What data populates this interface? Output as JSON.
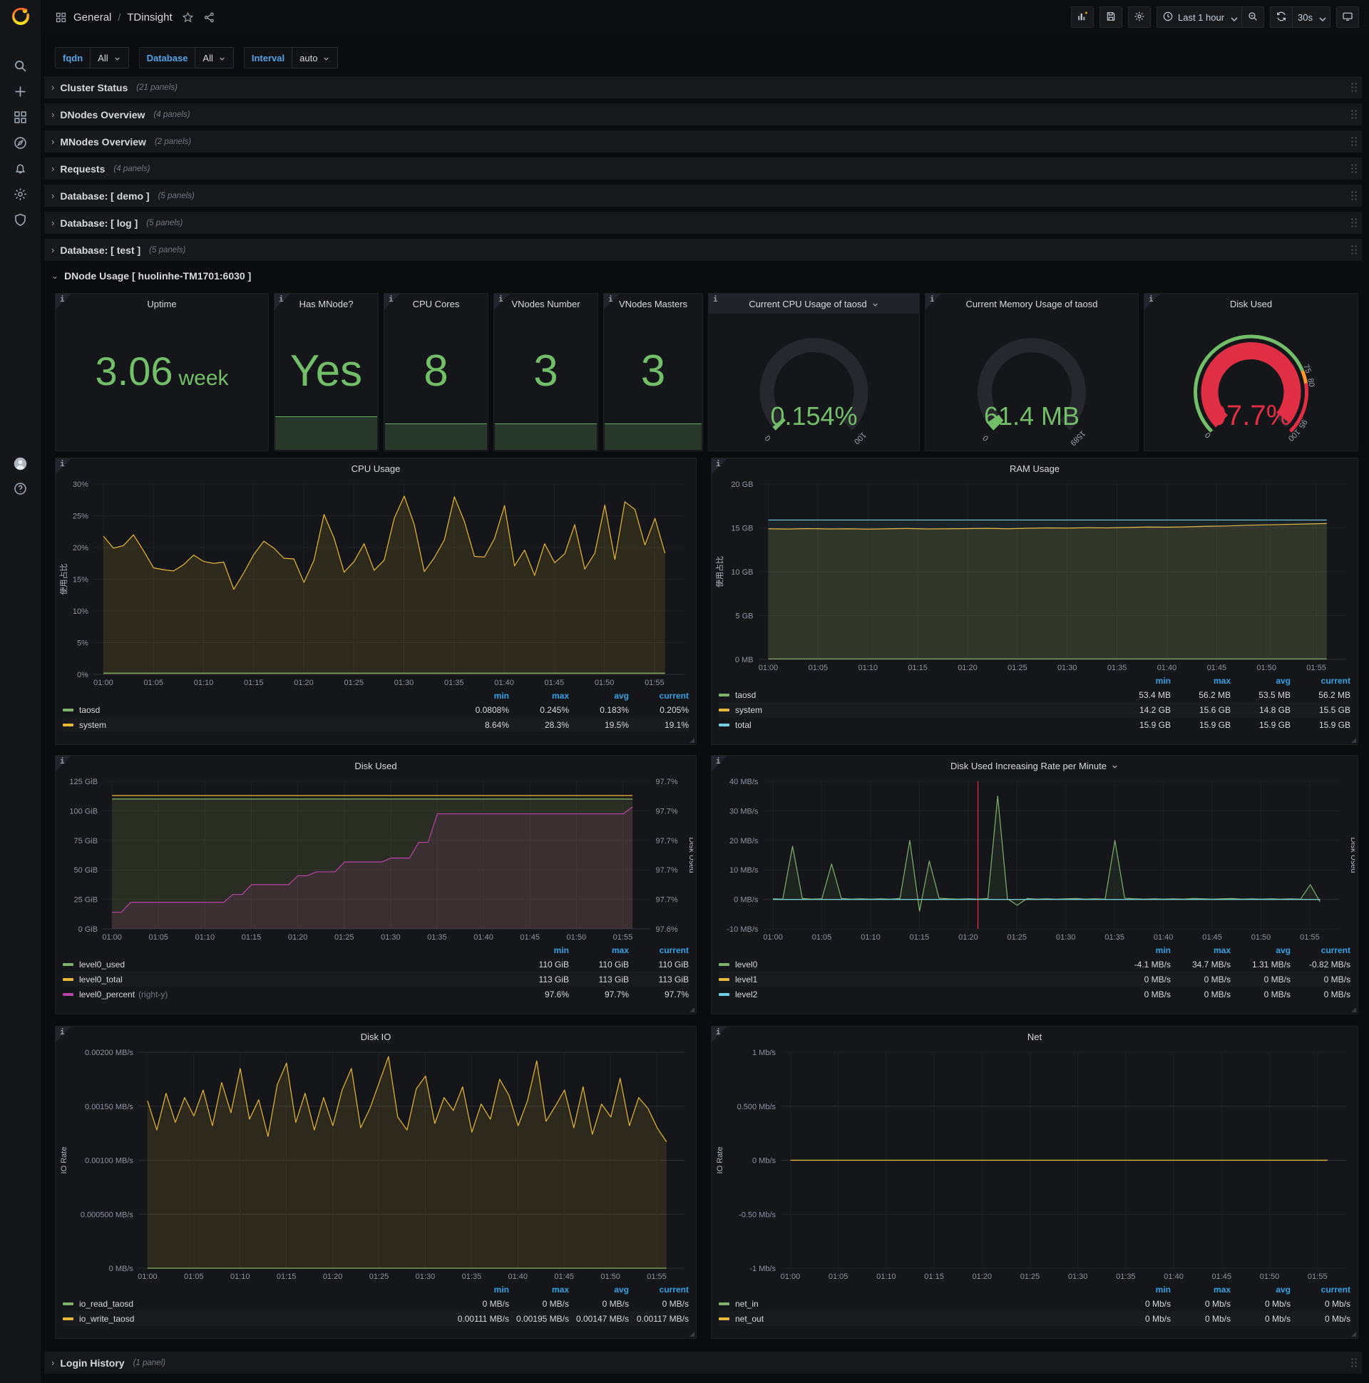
{
  "topnav": {
    "breadcrumb_root": "General",
    "breadcrumb_sep": "/",
    "dashboard_title": "TDinsight",
    "time_range": "Last 1 hour",
    "refresh_interval": "30s"
  },
  "sidebar": {
    "icons": [
      "search-icon",
      "plus-icon",
      "dashboards-icon",
      "explore-compass-icon",
      "alerting-bell-icon",
      "configuration-gear-icon",
      "server-admin-shield-icon"
    ],
    "bottom_icons": [
      "user-avatar-icon",
      "help-icon"
    ]
  },
  "variables": [
    {
      "label": "fqdn",
      "value": "All"
    },
    {
      "label": "Database",
      "value": "All"
    },
    {
      "label": "Interval",
      "value": "auto"
    }
  ],
  "collapsed_rows": [
    {
      "label": "Cluster Status",
      "count": "(21 panels)"
    },
    {
      "label": "DNodes Overview",
      "count": "(4 panels)"
    },
    {
      "label": "MNodes Overview",
      "count": "(2 panels)"
    },
    {
      "label": "Requests",
      "count": "(4 panels)"
    },
    {
      "label": "Database: [ demo ]",
      "count": "(5 panels)"
    },
    {
      "label": "Database: [ log ]",
      "count": "(5 panels)"
    },
    {
      "label": "Database: [ test ]",
      "count": "(5 panels)"
    }
  ],
  "expanded_row_title": "DNode Usage [ huolinhe-TM1701:6030 ]",
  "bottom_row": {
    "label": "Login History",
    "count": "(1 panel)"
  },
  "colors": {
    "green": "#73bf69",
    "series_green": "#7EB26D",
    "series_yellow": "#EAB839",
    "series_cyan": "#6ED0E0",
    "series_magenta": "#BA43A9",
    "red": "#e02f44",
    "orange": "#ff9830",
    "legend_header_blue": "#33a2e5"
  },
  "stat_panels": [
    {
      "title": "Uptime",
      "value": "3.06",
      "suffix": "week",
      "sparkline": false
    },
    {
      "title": "Has MNode?",
      "value": "Yes",
      "sparkline": true,
      "spark_h": 47
    },
    {
      "title": "CPU Cores",
      "value": "8",
      "sparkline": true,
      "spark_h": 37
    },
    {
      "title": "VNodes Number",
      "value": "3",
      "sparkline": true,
      "spark_h": 37
    },
    {
      "title": "VNodes Masters",
      "value": "3",
      "sparkline": true,
      "spark_h": 37
    }
  ],
  "gauge_panels": [
    {
      "title": "Current CPU Usage of taosd",
      "has_dropdown": true,
      "header_highlight": true,
      "value": "0.154%",
      "percent_of_max": 0.154,
      "min_label": "0",
      "max_label": "100",
      "value_color": "#73bf69",
      "arc_color": "#73bf69"
    },
    {
      "title": "Current Memory Usage of taosd",
      "has_dropdown": false,
      "header_highlight": false,
      "value": "61.4 MB",
      "percent_of_max": 3.9,
      "min_label": "0",
      "max_label": "1589",
      "value_color": "#73bf69",
      "arc_color": "#73bf69"
    },
    {
      "title": "Disk Used",
      "has_dropdown": false,
      "header_highlight": false,
      "value": "97.7%",
      "percent_of_max": 97.7,
      "min_label": "0",
      "max_label": "100",
      "value_color": "#e02f44",
      "arc_color": "#e02f44",
      "threshold_ring": [
        {
          "to": 75,
          "color": "#73bf69"
        },
        {
          "to": 80,
          "color": "#ff9830"
        },
        {
          "to": 100,
          "color": "#e02f44"
        }
      ],
      "threshold_labels": [
        {
          "value": 75,
          "text": "75"
        },
        {
          "value": 80,
          "text": "80"
        },
        {
          "value": 95,
          "text": "95"
        }
      ]
    }
  ],
  "time_ticks": [
    "01:00",
    "01:05",
    "01:10",
    "01:15",
    "01:20",
    "01:25",
    "01:30",
    "01:35",
    "01:40",
    "01:45",
    "01:50",
    "01:55"
  ],
  "chart_data": [
    {
      "key": "cpu_usage",
      "type": "line",
      "title": "CPU Usage",
      "ylabel": "使用占比",
      "y_ticks": [
        "0%",
        "5%",
        "10%",
        "15%",
        "20%",
        "25%",
        "30%"
      ],
      "ylim": [
        0,
        30
      ],
      "grid": true,
      "legend_position": "bottom",
      "series": [
        {
          "name": "taosd",
          "color": "#7EB26D",
          "fill": 0.1,
          "values": [
            0.2,
            0.2
          ]
        },
        {
          "name": "system",
          "color": "#EAB839",
          "fill": 0.13,
          "values": [
            21.8,
            19.9,
            20.3,
            22.0,
            19.5,
            16.8,
            16.5,
            16.3,
            17.3,
            18.8,
            17.8,
            17.5,
            17.7,
            13.4,
            16.0,
            18.9,
            21.0,
            19.9,
            18.3,
            18.2,
            14.5,
            18.0,
            25.2,
            21.5,
            16.1,
            17.8,
            20.6,
            16.4,
            18.0,
            24.6,
            28.1,
            23.6,
            16.2,
            18.4,
            21.2,
            28.0,
            24.1,
            18.6,
            18.5,
            21.4,
            26.6,
            17.1,
            19.6,
            15.6,
            20.6,
            17.6,
            19.0,
            23.6,
            16.6,
            19.1,
            26.7,
            18.1,
            27.2,
            26.0,
            20.4,
            24.6,
            19.1
          ]
        }
      ],
      "legend": {
        "columns": [
          "min",
          "max",
          "avg",
          "current"
        ],
        "rows": [
          {
            "name": "taosd",
            "color": "#7EB26D",
            "values": [
              "0.0808%",
              "0.245%",
              "0.183%",
              "0.205%"
            ]
          },
          {
            "name": "system",
            "color": "#EAB839",
            "values": [
              "8.64%",
              "28.3%",
              "19.5%",
              "19.1%"
            ]
          }
        ]
      }
    },
    {
      "key": "ram_usage",
      "type": "line",
      "title": "RAM Usage",
      "ylabel": "使用占比",
      "y_ticks": [
        "0 MB",
        "5 GB",
        "10 GB",
        "15 GB",
        "20 GB"
      ],
      "ylim": [
        0,
        20
      ],
      "grid": true,
      "legend_position": "bottom",
      "series": [
        {
          "name": "taosd",
          "color": "#7EB26D",
          "fill": 0.1,
          "values": [
            0.055,
            0.055
          ]
        },
        {
          "name": "system",
          "color": "#EAB839",
          "fill": 0.12,
          "values": [
            14.9,
            14.87,
            14.92,
            14.88,
            14.9,
            14.86,
            14.9,
            14.93,
            14.88,
            14.9,
            14.92,
            14.95,
            14.9,
            14.96,
            15.0,
            14.98,
            15.02,
            15.0,
            15.05,
            15.1,
            15.08,
            15.12,
            15.18,
            15.22,
            15.3,
            15.35,
            15.4,
            15.45,
            15.5
          ]
        },
        {
          "name": "total",
          "color": "#6ED0E0",
          "fill": 0.07,
          "values": [
            15.9,
            15.9
          ]
        }
      ],
      "legend": {
        "columns": [
          "min",
          "max",
          "avg",
          "current"
        ],
        "rows": [
          {
            "name": "taosd",
            "color": "#7EB26D",
            "values": [
              "53.4 MB",
              "56.2 MB",
              "53.5 MB",
              "56.2 MB"
            ]
          },
          {
            "name": "system",
            "color": "#EAB839",
            "values": [
              "14.2 GB",
              "15.6 GB",
              "14.8 GB",
              "15.5 GB"
            ]
          },
          {
            "name": "total",
            "color": "#6ED0E0",
            "values": [
              "15.9 GB",
              "15.9 GB",
              "15.9 GB",
              "15.9 GB"
            ]
          }
        ]
      }
    },
    {
      "key": "disk_used",
      "type": "line",
      "title": "Disk Used",
      "ylabel": null,
      "y_ticks": [
        "0 GiB",
        "25 GiB",
        "50 GiB",
        "75 GiB",
        "100 GiB",
        "125 GiB"
      ],
      "ylim": [
        0,
        125
      ],
      "y2label": "Disk Used",
      "y2_ticks": [
        "97.6%",
        "97.7%",
        "97.7%",
        "97.7%",
        "97.7%",
        "97.7%"
      ],
      "y2lim": [
        97.58,
        97.73
      ],
      "grid": true,
      "legend_position": "bottom",
      "series": [
        {
          "name": "level0_used",
          "color": "#7EB26D",
          "fill": 0.1,
          "values": [
            110,
            110
          ]
        },
        {
          "name": "level0_total",
          "color": "#EAB839",
          "fill": 0.06,
          "values": [
            113,
            113
          ]
        },
        {
          "name": "level0_percent",
          "color": "#BA43A9",
          "fill": 0.12,
          "axis": "right",
          "values": [
            97.597,
            97.597,
            97.607,
            97.607,
            97.607,
            97.607,
            97.607,
            97.607,
            97.607,
            97.607,
            97.607,
            97.607,
            97.607,
            97.615,
            97.615,
            97.625,
            97.625,
            97.625,
            97.625,
            97.625,
            97.634,
            97.634,
            97.638,
            97.638,
            97.638,
            97.648,
            97.648,
            97.648,
            97.648,
            97.648,
            97.652,
            97.652,
            97.652,
            97.668,
            97.668,
            97.697,
            97.697,
            97.697,
            97.697,
            97.697,
            97.697,
            97.697,
            97.697,
            97.697,
            97.697,
            97.697,
            97.697,
            97.697,
            97.697,
            97.697,
            97.697,
            97.697,
            97.697,
            97.697,
            97.697,
            97.697,
            97.704
          ]
        }
      ],
      "legend": {
        "columns": [
          "min",
          "max",
          "current"
        ],
        "rows": [
          {
            "name": "level0_used",
            "color": "#7EB26D",
            "values": [
              "110 GiB",
              "110 GiB",
              "110 GiB"
            ]
          },
          {
            "name": "level0_total",
            "color": "#EAB839",
            "values": [
              "113 GiB",
              "113 GiB",
              "113 GiB"
            ]
          },
          {
            "name": "level0_percent",
            "note": "(right-y)",
            "color": "#BA43A9",
            "values": [
              "97.6%",
              "97.7%",
              "97.7%"
            ]
          }
        ]
      }
    },
    {
      "key": "disk_rate",
      "type": "line",
      "title": "Disk Used Increasing Rate per Minute",
      "title_dropdown": true,
      "ylabel": null,
      "y_ticks": [
        "-10 MB/s",
        "0 MB/s",
        "10 MB/s",
        "20 MB/s",
        "30 MB/s",
        "40 MB/s"
      ],
      "ylim": [
        -10,
        40
      ],
      "y2label": "Disk Used",
      "annotation": {
        "time": "01:21",
        "color": "#e02f44"
      },
      "grid": true,
      "legend_position": "bottom",
      "series": [
        {
          "name": "level0",
          "color": "#7EB26D",
          "fill": 0.1,
          "values": [
            0.2,
            0.1,
            18,
            0.3,
            0.1,
            0.2,
            12,
            0.3,
            0.1,
            0.2,
            0.1,
            0.2,
            0.1,
            0.3,
            20,
            -4,
            13,
            0.4,
            0.2,
            0.1,
            0.2,
            0.1,
            0.3,
            35,
            0.2,
            -2,
            0.3,
            0.1,
            0.2,
            0.1,
            0.2,
            0.3,
            0.1,
            0.2,
            0.1,
            20,
            0.4,
            0.2,
            0.1,
            0.2,
            0.1,
            0.2,
            0.1,
            0.3,
            0.2,
            0.1,
            0.2,
            0.3,
            0.1,
            0.2,
            0.1,
            0.2,
            0.1,
            0.2,
            0.1,
            5,
            -0.8
          ]
        },
        {
          "name": "level1",
          "color": "#EAB839",
          "fill": 0,
          "values": [
            0,
            0
          ]
        },
        {
          "name": "level2",
          "color": "#6ED0E0",
          "fill": 0,
          "values": [
            0,
            0
          ]
        }
      ],
      "legend": {
        "columns": [
          "min",
          "max",
          "avg",
          "current"
        ],
        "rows": [
          {
            "name": "level0",
            "color": "#7EB26D",
            "values": [
              "-4.1 MB/s",
              "34.7 MB/s",
              "1.31 MB/s",
              "-0.82 MB/s"
            ]
          },
          {
            "name": "level1",
            "color": "#EAB839",
            "values": [
              "0 MB/s",
              "0 MB/s",
              "0 MB/s",
              "0 MB/s"
            ]
          },
          {
            "name": "level2",
            "color": "#6ED0E0",
            "values": [
              "0 MB/s",
              "0 MB/s",
              "0 MB/s",
              "0 MB/s"
            ]
          }
        ]
      }
    },
    {
      "key": "disk_io",
      "type": "line",
      "title": "Disk IO",
      "ylabel": "IO Rate",
      "y_ticks": [
        "0 MB/s",
        "0.000500 MB/s",
        "0.00100 MB/s",
        "0.00150 MB/s",
        "0.00200 MB/s"
      ],
      "ylim": [
        0,
        0.002
      ],
      "grid": true,
      "legend_position": "bottom",
      "series": [
        {
          "name": "io_read_taosd",
          "color": "#7EB26D",
          "fill": 0.1,
          "values": [
            0,
            0
          ]
        },
        {
          "name": "io_write_taosd",
          "color": "#EAB839",
          "fill": 0.12,
          "values": [
            0.00155,
            0.00128,
            0.00162,
            0.00135,
            0.00158,
            0.00141,
            0.00165,
            0.00132,
            0.00172,
            0.00144,
            0.00185,
            0.00138,
            0.00156,
            0.00122,
            0.0017,
            0.0019,
            0.00135,
            0.00162,
            0.00128,
            0.00158,
            0.00132,
            0.00165,
            0.00185,
            0.0013,
            0.00148,
            0.00172,
            0.00196,
            0.0014,
            0.00128,
            0.00166,
            0.00178,
            0.00134,
            0.00158,
            0.00146,
            0.00168,
            0.00126,
            0.00152,
            0.00138,
            0.00175,
            0.0016,
            0.00132,
            0.00155,
            0.00192,
            0.00136,
            0.0015,
            0.00165,
            0.0013,
            0.00168,
            0.00124,
            0.00152,
            0.0014,
            0.00176,
            0.00132,
            0.00158,
            0.00148,
            0.0013,
            0.00117
          ]
        }
      ],
      "legend": {
        "columns": [
          "min",
          "max",
          "avg",
          "current"
        ],
        "rows": [
          {
            "name": "io_read_taosd",
            "color": "#7EB26D",
            "values": [
              "0 MB/s",
              "0 MB/s",
              "0 MB/s",
              "0 MB/s"
            ]
          },
          {
            "name": "io_write_taosd",
            "color": "#EAB839",
            "values": [
              "0.00111 MB/s",
              "0.00195 MB/s",
              "0.00147 MB/s",
              "0.00117 MB/s"
            ]
          }
        ]
      }
    },
    {
      "key": "net",
      "type": "line",
      "title": "Net",
      "ylabel": "IO Rate",
      "y_ticks": [
        "-1 Mb/s",
        "-0.50 Mb/s",
        "0 Mb/s",
        "0.500 Mb/s",
        "1 Mb/s"
      ],
      "ylim": [
        -1,
        1
      ],
      "grid": true,
      "legend_position": "bottom",
      "series": [
        {
          "name": "net_in",
          "color": "#7EB26D",
          "fill": 0,
          "values": [
            0,
            0
          ]
        },
        {
          "name": "net_out",
          "color": "#EAB839",
          "fill": 0,
          "values": [
            0,
            0
          ]
        }
      ],
      "legend": {
        "columns": [
          "min",
          "max",
          "avg",
          "current"
        ],
        "rows": [
          {
            "name": "net_in",
            "color": "#7EB26D",
            "values": [
              "0 Mb/s",
              "0 Mb/s",
              "0 Mb/s",
              "0 Mb/s"
            ]
          },
          {
            "name": "net_out",
            "color": "#EAB839",
            "values": [
              "0 Mb/s",
              "0 Mb/s",
              "0 Mb/s",
              "0 Mb/s"
            ]
          }
        ]
      }
    }
  ]
}
